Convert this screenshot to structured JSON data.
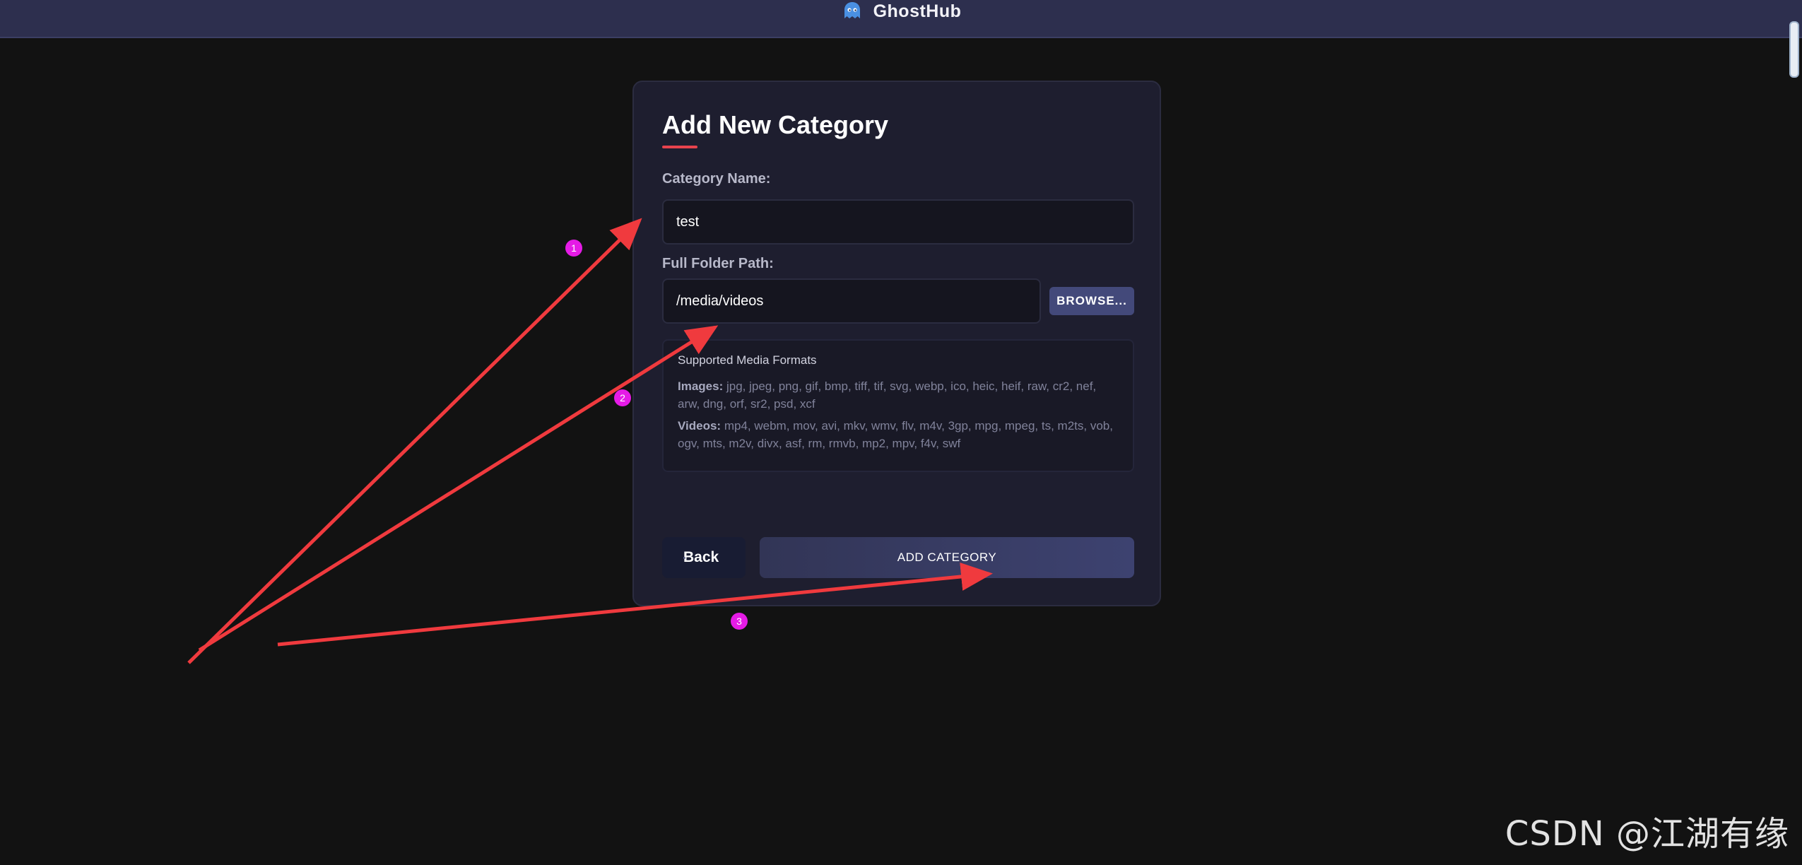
{
  "app": {
    "name": "GhostHub",
    "logo_icon": "ghost-icon"
  },
  "form": {
    "title": "Add New Category",
    "category_name": {
      "label": "Category Name:",
      "value": "test"
    },
    "folder_path": {
      "label": "Full Folder Path:",
      "value": "/media/videos"
    },
    "browse_label": "BROWSE...",
    "formats": {
      "title": "Supported Media Formats",
      "images_label": "Images:",
      "images_list": "jpg, jpeg, png, gif, bmp, tiff, tif, svg, webp, ico, heic, heif, raw, cr2, nef, arw, dng, orf, sr2, psd, xcf",
      "videos_label": "Videos:",
      "videos_list": "mp4, webm, mov, avi, mkv, wmv, flv, m4v, 3gp, mpg, mpeg, ts, m2ts, vob, ogv, mts, m2v, divx, asf, rm, rmvb, mp2, mpv, f4v, swf"
    },
    "back_label": "Back",
    "submit_label": "ADD CATEGORY"
  },
  "annotations": {
    "arrow_color": "#f03a3e",
    "badge_color": "#e51be6",
    "badges": [
      "1",
      "2",
      "3"
    ]
  },
  "colors": {
    "background": "#121212",
    "header": "#2d2f4e",
    "card": "#1e1e2f",
    "accent": "#e8434d",
    "button": "#43497a"
  },
  "watermark": "CSDN @江湖有缘"
}
